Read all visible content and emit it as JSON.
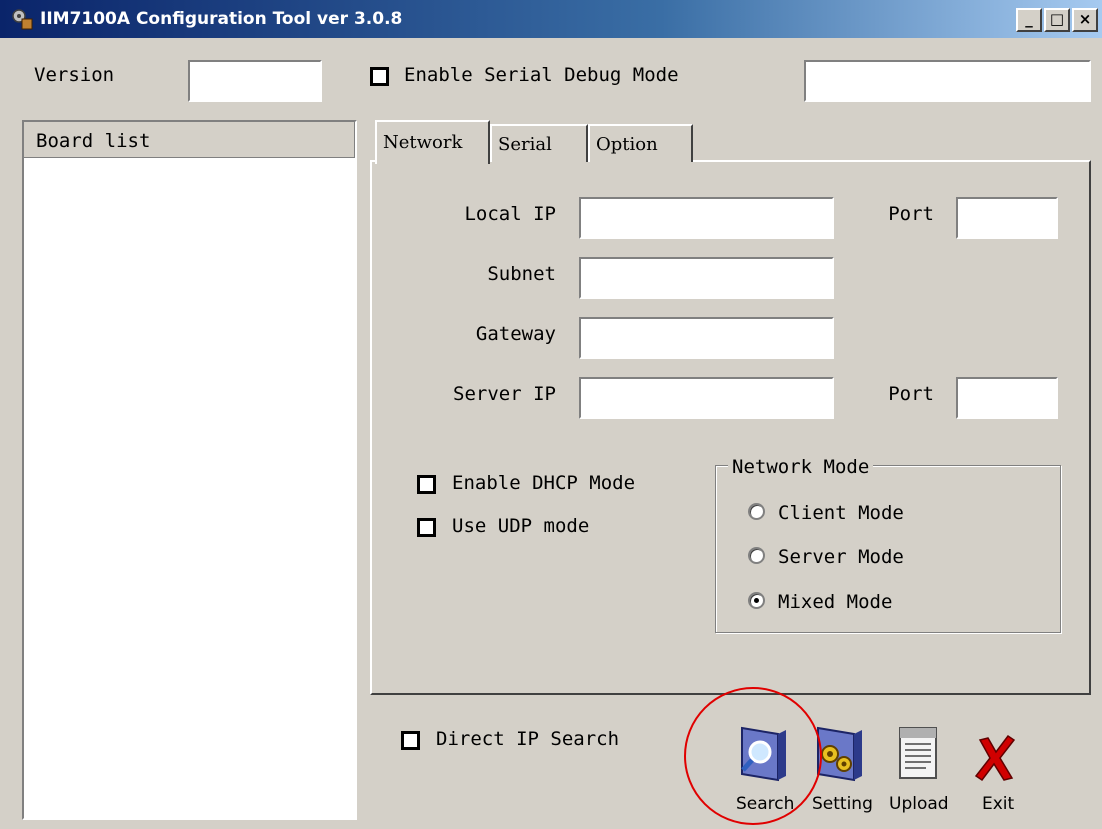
{
  "window": {
    "title": "IIM7100A Configuration Tool ver 3.0.8",
    "controls": [
      "minimize",
      "maximize",
      "close"
    ]
  },
  "header": {
    "version_label": "Version",
    "version_value": "",
    "serial_debug_label": "Enable Serial Debug Mode",
    "serial_debug_checked": false,
    "serial_debug_value": ""
  },
  "board_list": {
    "header": "Board list",
    "items": []
  },
  "tabs": {
    "network": "Network",
    "serial": "Serial",
    "option": "Option",
    "active": "Network"
  },
  "network": {
    "local_ip_label": "Local IP",
    "local_ip_value": "",
    "port1_label": "Port",
    "port1_value": "",
    "subnet_label": "Subnet",
    "subnet_value": "",
    "gateway_label": "Gateway",
    "gateway_value": "",
    "server_ip_label": "Server IP",
    "server_ip_value": "",
    "port2_label": "Port",
    "port2_value": "",
    "dhcp_label": "Enable DHCP Mode",
    "dhcp_checked": false,
    "udp_label": "Use UDP mode",
    "udp_checked": false
  },
  "network_mode": {
    "title": "Network Mode",
    "options": [
      "Client Mode",
      "Server Mode",
      "Mixed Mode"
    ],
    "selected": "Mixed Mode"
  },
  "footer": {
    "direct_ip_label": "Direct IP Search",
    "direct_ip_checked": false,
    "search_label": "Search",
    "setting_label": "Setting",
    "upload_label": "Upload",
    "exit_label": "Exit"
  },
  "colors": {
    "titlebar_start": "#0a246a",
    "titlebar_end": "#a6caf0",
    "face": "#d4d0c8",
    "highlight_circle": "#e00000",
    "exit_red": "#d00000"
  },
  "icons": [
    "app-icon",
    "search-icon",
    "setting-icon",
    "upload-icon",
    "exit-icon"
  ]
}
